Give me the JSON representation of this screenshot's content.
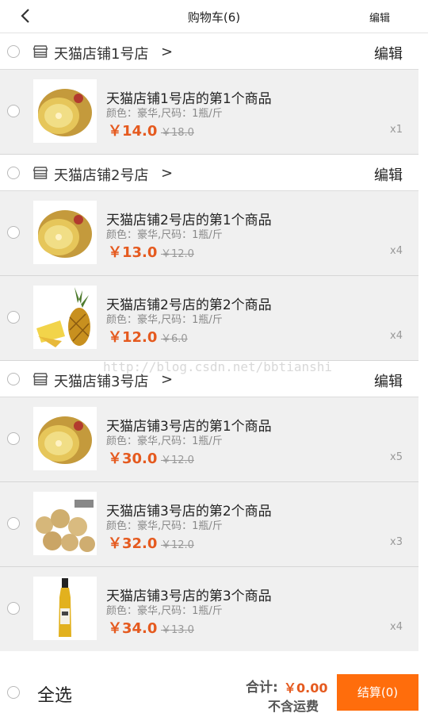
{
  "header": {
    "title": "购物车(6)",
    "edit_label": "编辑"
  },
  "shops": [
    {
      "name": "天猫店铺1号店",
      "edit_label": "编辑",
      "items": [
        {
          "name": "天猫店铺1号店的第1个商品",
          "spec": "颜色：豪华,尺码：1瓶/斤",
          "price": "￥14.0",
          "old_price": "￥18.0",
          "qty": "x1",
          "image": "kiwi"
        }
      ]
    },
    {
      "name": "天猫店铺2号店",
      "edit_label": "编辑",
      "items": [
        {
          "name": "天猫店铺2号店的第1个商品",
          "spec": "颜色：豪华,尺码：1瓶/斤",
          "price": "￥13.0",
          "old_price": "￥12.0",
          "qty": "x4",
          "image": "kiwi"
        },
        {
          "name": "天猫店铺2号店的第2个商品",
          "spec": "颜色：豪华,尺码：1瓶/斤",
          "price": "￥12.0",
          "old_price": "￥6.0",
          "qty": "x4",
          "image": "pineapple"
        }
      ]
    },
    {
      "name": "天猫店铺3号店",
      "edit_label": "编辑",
      "items": [
        {
          "name": "天猫店铺3号店的第1个商品",
          "spec": "颜色：豪华,尺码：1瓶/斤",
          "price": "￥30.0",
          "old_price": "￥12.0",
          "qty": "x5",
          "image": "kiwi"
        },
        {
          "name": "天猫店铺3号店的第2个商品",
          "spec": "颜色：豪华,尺码：1瓶/斤",
          "price": "￥32.0",
          "old_price": "￥12.0",
          "qty": "x3",
          "image": "longan"
        },
        {
          "name": "天猫店铺3号店的第3个商品",
          "spec": "颜色：豪华,尺码：1瓶/斤",
          "price": "￥34.0",
          "old_price": "￥13.0",
          "qty": "x4",
          "image": "oil-bottle"
        }
      ]
    }
  ],
  "footer": {
    "select_all": "全选",
    "total_label": "合计:",
    "total_value": "￥0.00",
    "freight_note": "不含运费",
    "checkout_label": "结算(0)"
  },
  "watermark": "http://blog.csdn.net/bbtianshi",
  "colors": {
    "price": "#e55a1f",
    "checkout": "#ff6d0c",
    "item_bg": "#f0f0f0"
  }
}
